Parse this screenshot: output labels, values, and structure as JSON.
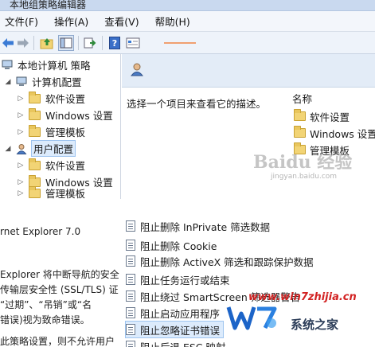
{
  "window": {
    "title": "本地组策略编辑器"
  },
  "menu": [
    {
      "label": "文件(F)"
    },
    {
      "label": "操作(A)"
    },
    {
      "label": "查看(V)"
    },
    {
      "label": "帮助(H)"
    }
  ],
  "tree": {
    "root": "本地计算机 策略",
    "computer_config": "计算机配置",
    "user_config": "用户配置",
    "computer_children": [
      "软件设置",
      "Windows 设置",
      "管理模板"
    ],
    "user_children": [
      "软件设置",
      "Windows 设置",
      "管理模板"
    ]
  },
  "right_pane": {
    "description": "选择一个项目来查看它的描述。",
    "column_name": "名称",
    "items": [
      "软件设置",
      "Windows 设置",
      "管理模板"
    ]
  },
  "bottom_left": {
    "lines": [
      "rnet Explorer 7.0",
      "Explorer 将中断导航的安全",
      "传输层安全性 (SSL/TLS) 证",
      "“过期”、“吊销”或“名",
      "错误)视为致命错误。",
      "此策略设置，则不允许用户"
    ]
  },
  "policies": [
    "阻止删除 InPrivate 筛选数据",
    "阻止删除 Cookie",
    "阻止删除 ActiveX 筛选和跟踪保护数据",
    "阻止任务运行或结束",
    "阻止绕过 SmartScreen 筛选器警告",
    "阻止启动应用程序",
    "阻止忽略证书错误",
    "阻止后退 ESC 映射"
  ],
  "watermarks": {
    "baidu": "Baidu 经验",
    "baidu_sub": "jingyan.baidu.com",
    "url": "www.win7zhijia.cn",
    "site": "系统之家"
  }
}
